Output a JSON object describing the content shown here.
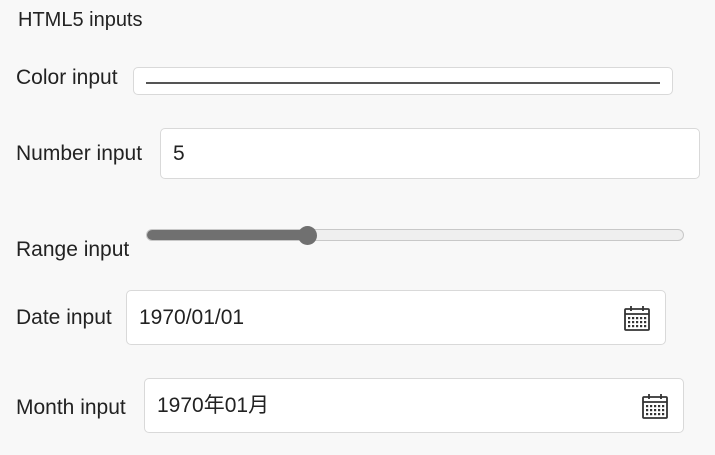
{
  "title": "HTML5 inputs",
  "color_input": {
    "label": "Color input",
    "value": "#555555"
  },
  "number_input": {
    "label": "Number input",
    "value": "5"
  },
  "range_input": {
    "label": "Range input",
    "fraction": 0.3
  },
  "date_input": {
    "label": "Date input",
    "value": "1970/01/01",
    "icon": "calendar-icon"
  },
  "month_input": {
    "label": "Month input",
    "value": "1970年01月",
    "icon": "calendar-icon"
  }
}
